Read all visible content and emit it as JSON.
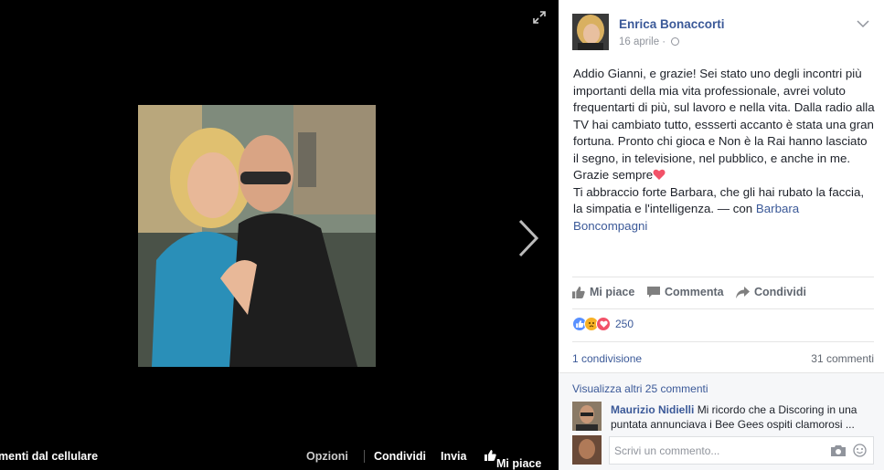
{
  "viewer": {
    "bottom_bar": {
      "left_label": "menti dal cellulare",
      "options_label": "Opzioni",
      "share_label": "Condividi",
      "send_label": "Invia",
      "like_label": "Mi piace"
    },
    "icons": [
      "expand-icon",
      "next-arrow-icon",
      "like-thumb-icon"
    ]
  },
  "post": {
    "author": "Enrica Bonaccorti",
    "date": "16 aprile · ",
    "privacy_icon": "globe-icon",
    "text_main": "Addio Gianni, e grazie! Sei stato uno degli incontri più importanti della mia vita professionale, avrei voluto frequentarti di più, sul lavoro e nella vita. Dalla radio alla TV hai cambiato tutto, essserti accanto è stata una gran fortuna. Pronto chi gioca e Non è la Rai hanno lasciato il segno, in televisione, nel pubblico, e anche in me. Grazie sempre",
    "text_second": "Ti abbraccio forte Barbara, che gli hai rubato la faccia, la simpatia e l'intelligenza. — con ",
    "tagged_person": "Barbara Boncompagni"
  },
  "actions": {
    "like_label": "Mi piace",
    "comment_label": "Commenta",
    "share_label": "Condividi"
  },
  "reactions": {
    "count": "250",
    "types": [
      "like",
      "sad",
      "love"
    ],
    "colors": {
      "like": "#5890ff",
      "sad": "#f7b125",
      "love": "#f25268"
    }
  },
  "stats": {
    "shares_label": "1 condivisione",
    "comments_label": "31 commenti"
  },
  "comments": {
    "more_label": "Visualizza altri 25 commenti",
    "items": [
      {
        "author": "Maurizio Nidielli",
        "text": "Mi ricordo che a Discoring in una puntata annunciava i Bee Gees ospiti clamorosi ..."
      }
    ],
    "input_placeholder": "Scrivi un commento..."
  },
  "colors": {
    "link": "#3b5998",
    "muted": "#90949c",
    "text": "#1d2129"
  }
}
